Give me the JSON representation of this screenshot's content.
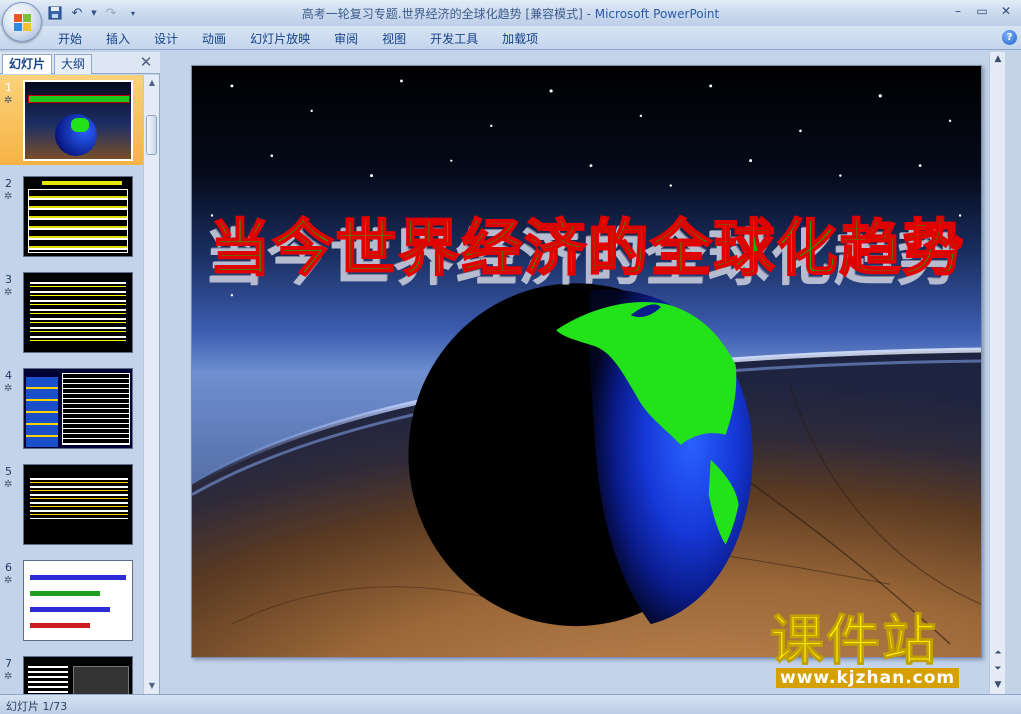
{
  "window": {
    "title": "高考一轮复习专题.世界经济的全球化趋势 [兼容模式] - ",
    "app_name": "Microsoft PowerPoint"
  },
  "quick_access": {
    "save_icon": "save-icon",
    "undo_icon": "undo-icon",
    "redo_icon": "redo-icon",
    "customize_icon": "customize-icon"
  },
  "ribbon": {
    "tabs": [
      "开始",
      "插入",
      "设计",
      "动画",
      "幻灯片放映",
      "审阅",
      "视图",
      "开发工具",
      "加载项"
    ]
  },
  "left_pane": {
    "tabs": [
      "幻灯片",
      "大纲"
    ],
    "slides": [
      {
        "num": "1",
        "selected": true
      },
      {
        "num": "2"
      },
      {
        "num": "3"
      },
      {
        "num": "4"
      },
      {
        "num": "5"
      },
      {
        "num": "6"
      },
      {
        "num": "7"
      }
    ]
  },
  "slide": {
    "title": "当今世界经济的全球化趋势"
  },
  "watermark": {
    "name": "课件站",
    "url": "www.kjzhan.com"
  },
  "status": {
    "text": "幻灯片 1/73"
  },
  "colors": {
    "title_fill": "#00c000",
    "title_outline": "#e00000",
    "selection": "#f7b245"
  }
}
